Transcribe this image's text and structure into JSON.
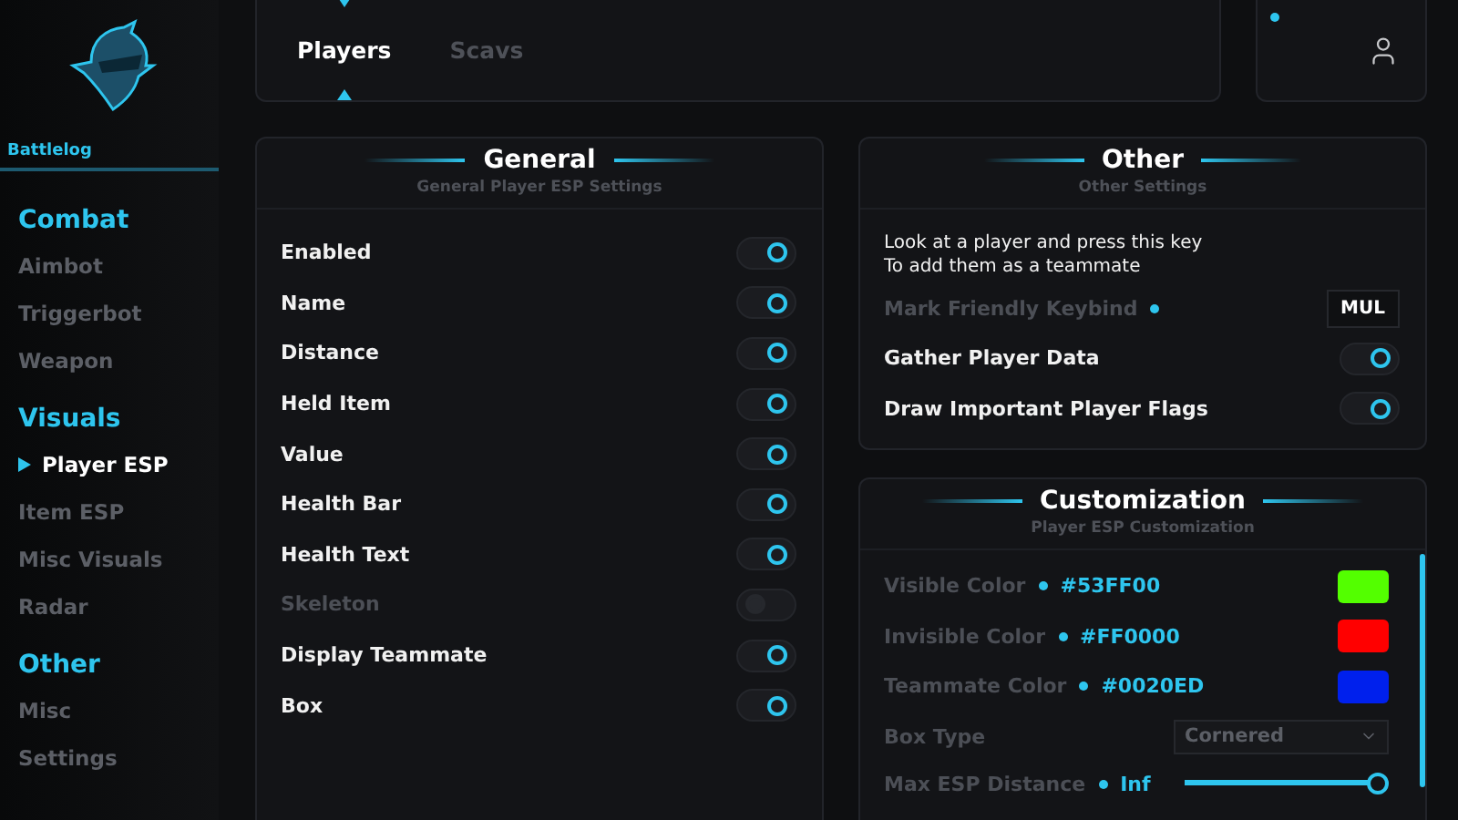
{
  "sidebar": {
    "brand": "Battlelog",
    "sections": [
      {
        "title": "Combat",
        "items": [
          {
            "label": "Aimbot",
            "selected": false
          },
          {
            "label": "Triggerbot",
            "selected": false
          },
          {
            "label": "Weapon",
            "selected": false
          }
        ]
      },
      {
        "title": "Visuals",
        "items": [
          {
            "label": "Player ESP",
            "selected": true
          },
          {
            "label": "Item ESP",
            "selected": false
          },
          {
            "label": "Misc Visuals",
            "selected": false
          },
          {
            "label": "Radar",
            "selected": false
          }
        ]
      },
      {
        "title": "Other",
        "items": [
          {
            "label": "Misc",
            "selected": false
          },
          {
            "label": "Settings",
            "selected": false
          }
        ]
      }
    ]
  },
  "tabs": [
    {
      "label": "Players",
      "selected": true
    },
    {
      "label": "Scavs",
      "selected": false
    }
  ],
  "general": {
    "title": "General",
    "subtitle": "General Player ESP Settings",
    "options": [
      {
        "label": "Enabled",
        "on": true,
        "disabled": false
      },
      {
        "label": "Name",
        "on": true,
        "disabled": false
      },
      {
        "label": "Distance",
        "on": true,
        "disabled": false
      },
      {
        "label": "Held Item",
        "on": true,
        "disabled": false
      },
      {
        "label": "Value",
        "on": true,
        "disabled": false
      },
      {
        "label": "Health Bar",
        "on": true,
        "disabled": false
      },
      {
        "label": "Health Text",
        "on": true,
        "disabled": false
      },
      {
        "label": "Skeleton",
        "on": false,
        "disabled": true
      },
      {
        "label": "Display Teammate",
        "on": true,
        "disabled": false
      },
      {
        "label": "Box",
        "on": true,
        "disabled": false
      }
    ]
  },
  "other": {
    "title": "Other",
    "subtitle": "Other Settings",
    "note": "Look at a player and press this key\nTo add them as a teammate",
    "rows": [
      {
        "kind": "keybind",
        "label": "Mark Friendly Keybind",
        "key": "MUL"
      },
      {
        "kind": "toggle",
        "label": "Gather Player Data",
        "on": true
      },
      {
        "kind": "toggle",
        "label": "Draw Important Player Flags",
        "on": true
      }
    ]
  },
  "customization": {
    "title": "Customization",
    "subtitle": "Player ESP Customization",
    "rows": [
      {
        "kind": "color",
        "label": "Visible Color",
        "value": "#53FF00",
        "color": "#53ff00"
      },
      {
        "kind": "color",
        "label": "Invisible Color",
        "value": "#FF0000",
        "color": "#ff0000"
      },
      {
        "kind": "color",
        "label": "Teammate Color",
        "value": "#0020ED",
        "color": "#0020ed"
      },
      {
        "kind": "select",
        "label": "Box Type",
        "value": "Cornered"
      },
      {
        "kind": "slider",
        "label": "Max ESP Distance",
        "value": "Inf",
        "level": 1
      }
    ]
  }
}
